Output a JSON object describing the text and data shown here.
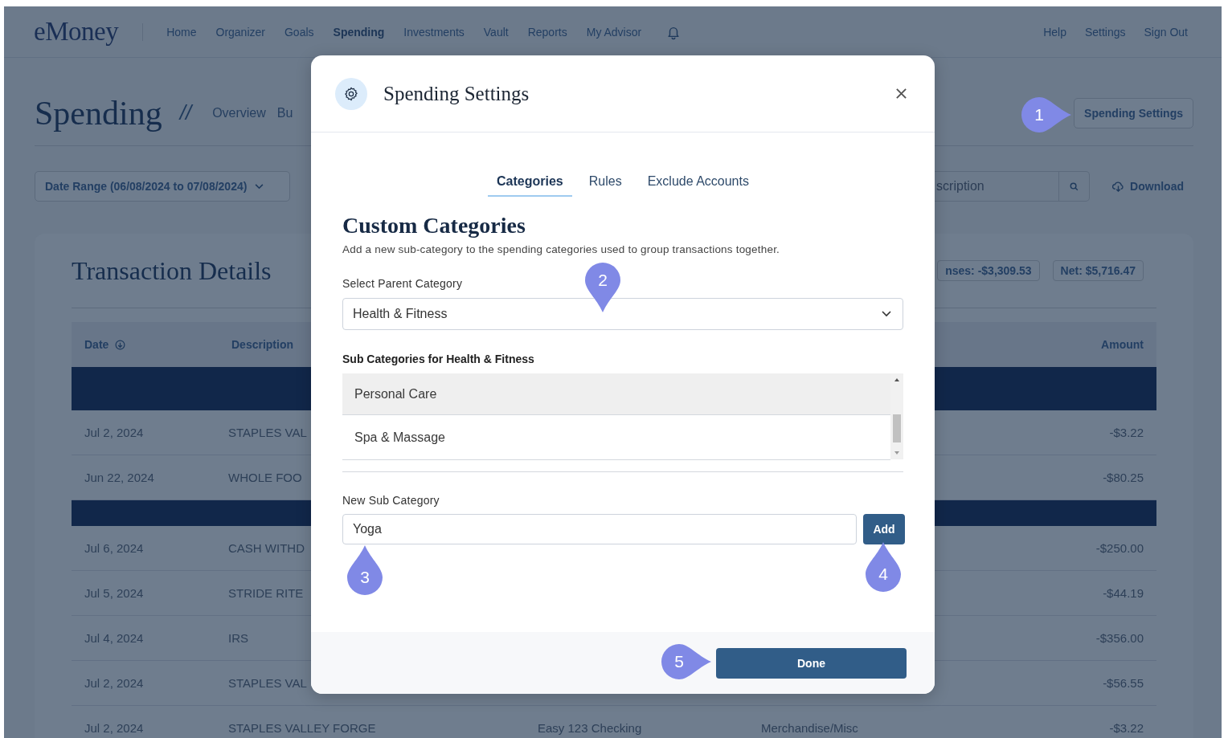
{
  "nav": {
    "logo": "eMoney",
    "items": [
      {
        "label": "Home",
        "selected": false
      },
      {
        "label": "Organizer",
        "selected": false
      },
      {
        "label": "Goals",
        "selected": false
      },
      {
        "label": "Spending",
        "selected": true
      },
      {
        "label": "Investments",
        "selected": false
      },
      {
        "label": "Vault",
        "selected": false
      },
      {
        "label": "Reports",
        "selected": false
      },
      {
        "label": "My Advisor",
        "selected": false
      }
    ],
    "links": [
      "Help",
      "Settings",
      "Sign Out"
    ]
  },
  "page": {
    "title": "Spending",
    "separator": "//",
    "subtabs": [
      "Overview",
      "Bu"
    ],
    "settings_button": "Spending Settings"
  },
  "filters": {
    "date_range": "Date Range (06/08/2024 to 07/08/2024)",
    "search_placeholder": "scription",
    "download": "Download"
  },
  "transactions": {
    "title": "Transaction Details",
    "badges": [
      "nses: -$3,309.53",
      "Net: $5,716.47"
    ],
    "columns": [
      "Date",
      "Description",
      "Amount"
    ],
    "rows": [
      {
        "kind": "group"
      },
      {
        "kind": "row",
        "cells": [
          "Jul 2, 2024",
          "STAPLES VAL"
        ],
        "amount": "-$3.22"
      },
      {
        "kind": "row",
        "cells": [
          "Jun 22, 2024",
          "WHOLE FOO"
        ],
        "amount": "-$80.25"
      },
      {
        "kind": "group"
      },
      {
        "kind": "row",
        "cells": [
          "Jul 6, 2024",
          "CASH WITHD"
        ],
        "amount": "-$250.00"
      },
      {
        "kind": "row",
        "cells": [
          "Jul 5, 2024",
          "STRIDE RITE"
        ],
        "amount": "-$44.19"
      },
      {
        "kind": "row",
        "cells": [
          "Jul 4, 2024",
          "IRS"
        ],
        "amount": "-$356.00"
      },
      {
        "kind": "row",
        "cells": [
          "Jul 2, 2024",
          "STAPLES VAL"
        ],
        "amount": "-$56.55"
      },
      {
        "kind": "row",
        "cells": [
          "Jul 2, 2024",
          "STAPLES VALLEY FORGE",
          "Easy 123 Checking",
          "Merchandise/Misc"
        ],
        "amount": "-$3.22"
      }
    ]
  },
  "modal": {
    "title": "Spending Settings",
    "tabs": [
      {
        "label": "Categories",
        "selected": true
      },
      {
        "label": "Rules",
        "selected": false
      },
      {
        "label": "Exclude Accounts",
        "selected": false
      }
    ],
    "heading": "Custom Categories",
    "description": "Add a new sub-category to the spending categories used to group transactions together.",
    "parent_label": "Select Parent Category",
    "parent_value": "Health & Fitness",
    "sub_heading": "Sub Categories for Health & Fitness",
    "sub_categories": [
      {
        "label": "Personal Care",
        "selected": true
      },
      {
        "label": "Spa & Massage",
        "selected": false
      }
    ],
    "new_label": "New Sub Category",
    "new_value": "Yoga",
    "add_button": "Add",
    "done_button": "Done"
  },
  "callouts": [
    {
      "number": "1",
      "kind": "right"
    },
    {
      "number": "2",
      "kind": "down"
    },
    {
      "number": "3",
      "kind": "up"
    },
    {
      "number": "4",
      "kind": "up"
    },
    {
      "number": "5",
      "kind": "right"
    }
  ]
}
